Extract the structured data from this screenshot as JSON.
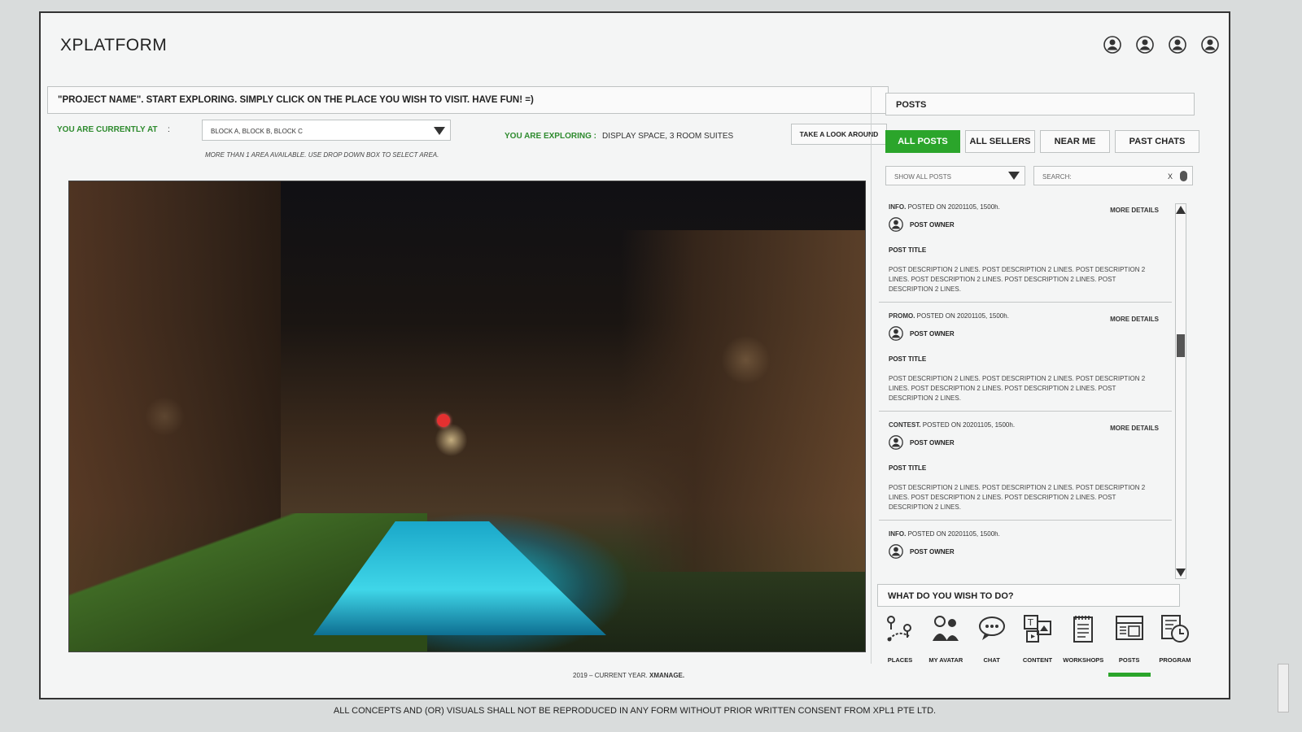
{
  "app": {
    "title": "XPLATFORM"
  },
  "header": {
    "icons": [
      "user-icon",
      "user-icon",
      "user-icon",
      "user-icon"
    ]
  },
  "banner": {
    "text": "\"PROJECT NAME\". START EXPLORING. SIMPLY CLICK ON THE PLACE YOU WISH TO VISIT. HAVE FUN! =)"
  },
  "location": {
    "label": "YOU ARE CURRENTLY AT",
    "colon": ":",
    "selected": "BLOCK A, BLOCK B, BLOCK C",
    "hint": "MORE THAN 1 AREA AVAILABLE. USE DROP DOWN BOX TO SELECT AREA."
  },
  "exploring": {
    "label": "YOU ARE EXPLORING :",
    "value": "DISPLAY SPACE, 3 ROOM SUITES"
  },
  "look_button": "TAKE A LOOK AROUND",
  "footer": {
    "year_text": "2019 – CURRENT YEAR.",
    "brand": "XMANAGE."
  },
  "copyright": "ALL CONCEPTS AND (OR) VISUALS SHALL NOT BE REPRODUCED IN ANY FORM WITHOUT PRIOR WRITTEN CONSENT FROM XPL1 PTE LTD.",
  "posts": {
    "header": "POSTS",
    "tabs": [
      {
        "label": "ALL POSTS",
        "active": true
      },
      {
        "label": "ALL SELLERS",
        "active": false
      },
      {
        "label": "NEAR ME",
        "active": false
      },
      {
        "label": "PAST CHATS",
        "active": false
      }
    ],
    "filter": "SHOW ALL POSTS",
    "search_placeholder": "SEARCH:",
    "search_clear": "X",
    "more_label": "MORE DETAILS",
    "items": [
      {
        "type": "INFO.",
        "meta": " POSTED ON 20201105, 1500h.",
        "owner": "POST OWNER",
        "title": "POST TITLE",
        "desc": "POST DESCRIPTION 2 LINES. POST DESCRIPTION 2 LINES. POST DESCRIPTION 2 LINES. POST DESCRIPTION 2 LINES. POST DESCRIPTION 2 LINES. POST DESCRIPTION 2 LINES."
      },
      {
        "type": "PROMO.",
        "meta": " POSTED ON 20201105, 1500h.",
        "owner": "POST OWNER",
        "title": "POST TITLE",
        "desc": "POST DESCRIPTION 2 LINES. POST DESCRIPTION 2 LINES. POST DESCRIPTION 2 LINES. POST DESCRIPTION 2 LINES. POST DESCRIPTION 2 LINES. POST DESCRIPTION 2 LINES."
      },
      {
        "type": "CONTEST.",
        "meta": " POSTED ON 20201105, 1500h.",
        "owner": "POST OWNER",
        "title": "POST TITLE",
        "desc": "POST DESCRIPTION 2 LINES. POST DESCRIPTION 2 LINES. POST DESCRIPTION 2 LINES. POST DESCRIPTION 2 LINES. POST DESCRIPTION 2 LINES. POST DESCRIPTION 2 LINES."
      },
      {
        "type": "INFO.",
        "meta": " POSTED ON 20201105, 1500h.",
        "owner": "POST OWNER"
      }
    ]
  },
  "wish": {
    "header": "WHAT DO YOU WISH TO DO?"
  },
  "actions": [
    {
      "label": "PLACES",
      "icon": "places-icon"
    },
    {
      "label": "MY AVATAR",
      "icon": "avatar-icon"
    },
    {
      "label": "CHAT",
      "icon": "chat-icon"
    },
    {
      "label": "CONTENT",
      "icon": "content-icon"
    },
    {
      "label": "WORKSHOPS",
      "icon": "workshops-icon"
    },
    {
      "label": "POSTS",
      "icon": "posts-icon",
      "active": true
    },
    {
      "label": "PROGRAM",
      "icon": "program-icon"
    }
  ],
  "colors": {
    "accent": "#2ba52b",
    "marker": "#e53030"
  }
}
